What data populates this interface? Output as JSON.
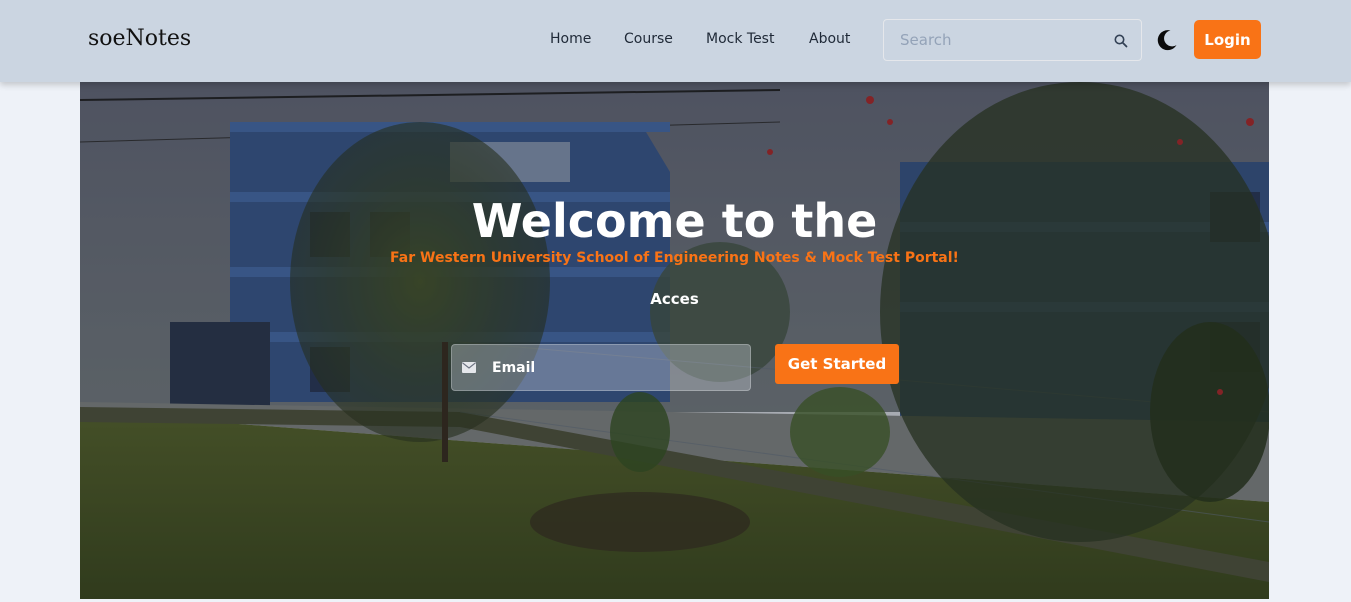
{
  "brand": "soeNotes",
  "nav": {
    "items": [
      {
        "label": "Home"
      },
      {
        "label": "Course"
      },
      {
        "label": "Mock Test"
      },
      {
        "label": "About"
      }
    ],
    "search_placeholder": "Search",
    "login_label": "Login"
  },
  "hero": {
    "title": "Welcome to the",
    "subtitle": "Far Western University School of Engineering Notes & Mock Test Portal!",
    "tagline": "Acces",
    "email_placeholder": "Email",
    "cta_label": "Get Started"
  },
  "colors": {
    "accent": "#f97316",
    "header_bg": "#cbd5e1",
    "page_bg": "#eef2f8"
  },
  "icons": {
    "search": "search-icon",
    "theme": "moon-icon",
    "email": "envelope-icon"
  }
}
